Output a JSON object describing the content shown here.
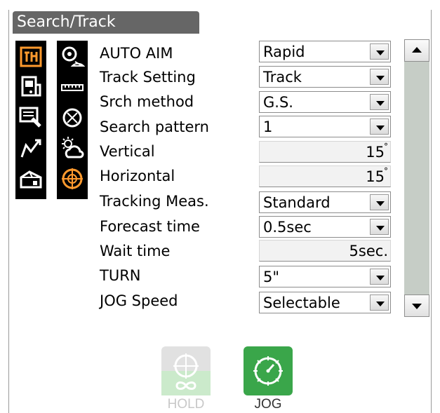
{
  "window": {
    "title": "Search/Track"
  },
  "icons": {
    "left": [
      {
        "name": "measurement-mode-icon",
        "color": "#ff9a2e"
      },
      {
        "name": "instrument-icon",
        "color": "#ffffff"
      },
      {
        "name": "data-record-icon",
        "color": "#ffffff"
      },
      {
        "name": "traverse-icon",
        "color": "#ffffff"
      },
      {
        "name": "box-icon",
        "color": "#ffffff"
      }
    ],
    "right": [
      {
        "name": "prism-icon",
        "color": "#ffffff"
      },
      {
        "name": "ruler-icon",
        "color": "#ffffff"
      },
      {
        "name": "target-icon",
        "color": "#ffffff"
      },
      {
        "name": "weather-icon",
        "color": "#ffffff"
      },
      {
        "name": "search-track-icon",
        "color": "#ff9a2e"
      }
    ]
  },
  "rows": [
    {
      "label": "AUTO AIM",
      "value": "Rapid",
      "type": "select"
    },
    {
      "label": "Track Setting",
      "value": "Track",
      "type": "select"
    },
    {
      "label": "Srch method",
      "value": "G.S.",
      "type": "select"
    },
    {
      "label": "Search pattern",
      "value": "1",
      "type": "select"
    },
    {
      "label": "Vertical",
      "value": "15",
      "unit": "°",
      "type": "readonly"
    },
    {
      "label": "Horizontal",
      "value": "15",
      "unit": "°",
      "type": "readonly"
    },
    {
      "label": "Tracking Meas.",
      "value": "Standard",
      "type": "select"
    },
    {
      "label": "Forecast time",
      "value": "0.5sec",
      "type": "select"
    },
    {
      "label": "Wait time",
      "value": "5sec.",
      "type": "readonly"
    },
    {
      "label": "TURN",
      "value": "5\"",
      "type": "select"
    },
    {
      "label": "JOG Speed",
      "value": "Selectable",
      "type": "select"
    }
  ],
  "actions": {
    "hold": {
      "label": "HOLD",
      "enabled": false,
      "color": "#8ed28e"
    },
    "jog": {
      "label": "JOG",
      "enabled": true,
      "color": "#3aa64a"
    }
  },
  "colors": {
    "accent": "#ff9a2e",
    "title_bg": "#666666",
    "scroll_track": "#c6cdc6"
  }
}
